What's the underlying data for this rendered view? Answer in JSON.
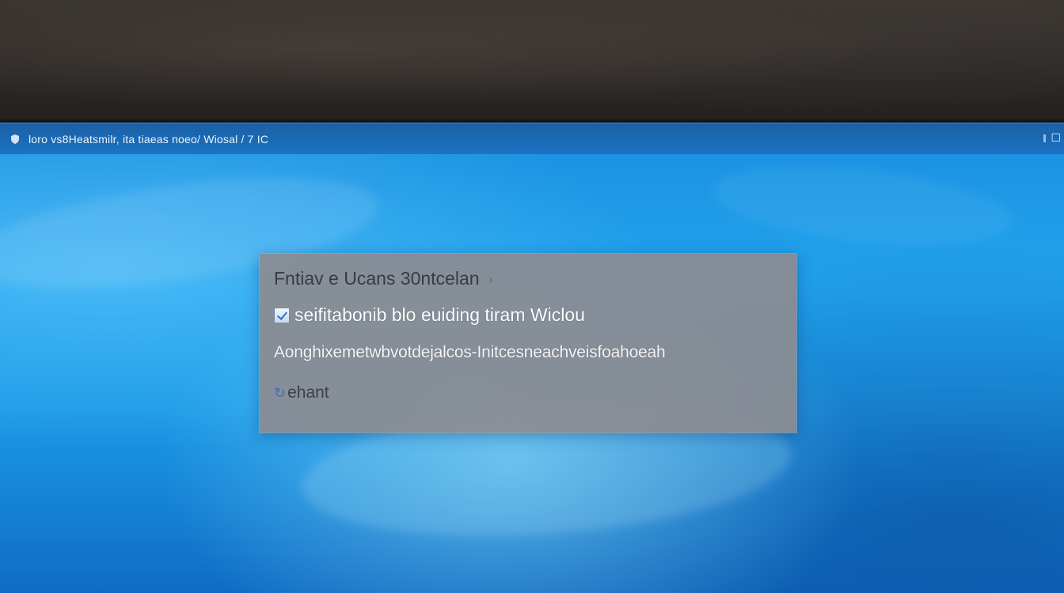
{
  "window": {
    "path_text": "loro vs8Heatsmilr, ita tiaeas noeo/ Wiosal / 7 IC",
    "app_icon": "shield-icon",
    "right_icon": "restore-icon",
    "right_icon_glyph": "☐"
  },
  "dialog": {
    "title": "Fntiav e Ucans 30ntcelan",
    "title_arrow": "›",
    "option_label": "seifitabonib blo euiding tiram Wiclou",
    "description": "Aonghixemetwbvotdejalcos-Initcesneachveisfoahoeah",
    "link_label": "ehant",
    "link_icon": "link-icon",
    "link_glyph": "↻",
    "checkbox_checked": true
  },
  "colors": {
    "screen_blue": "#1c9ae8",
    "titlebar_blue": "#1a6ab6",
    "dialog_gray": "#8c8c91"
  }
}
